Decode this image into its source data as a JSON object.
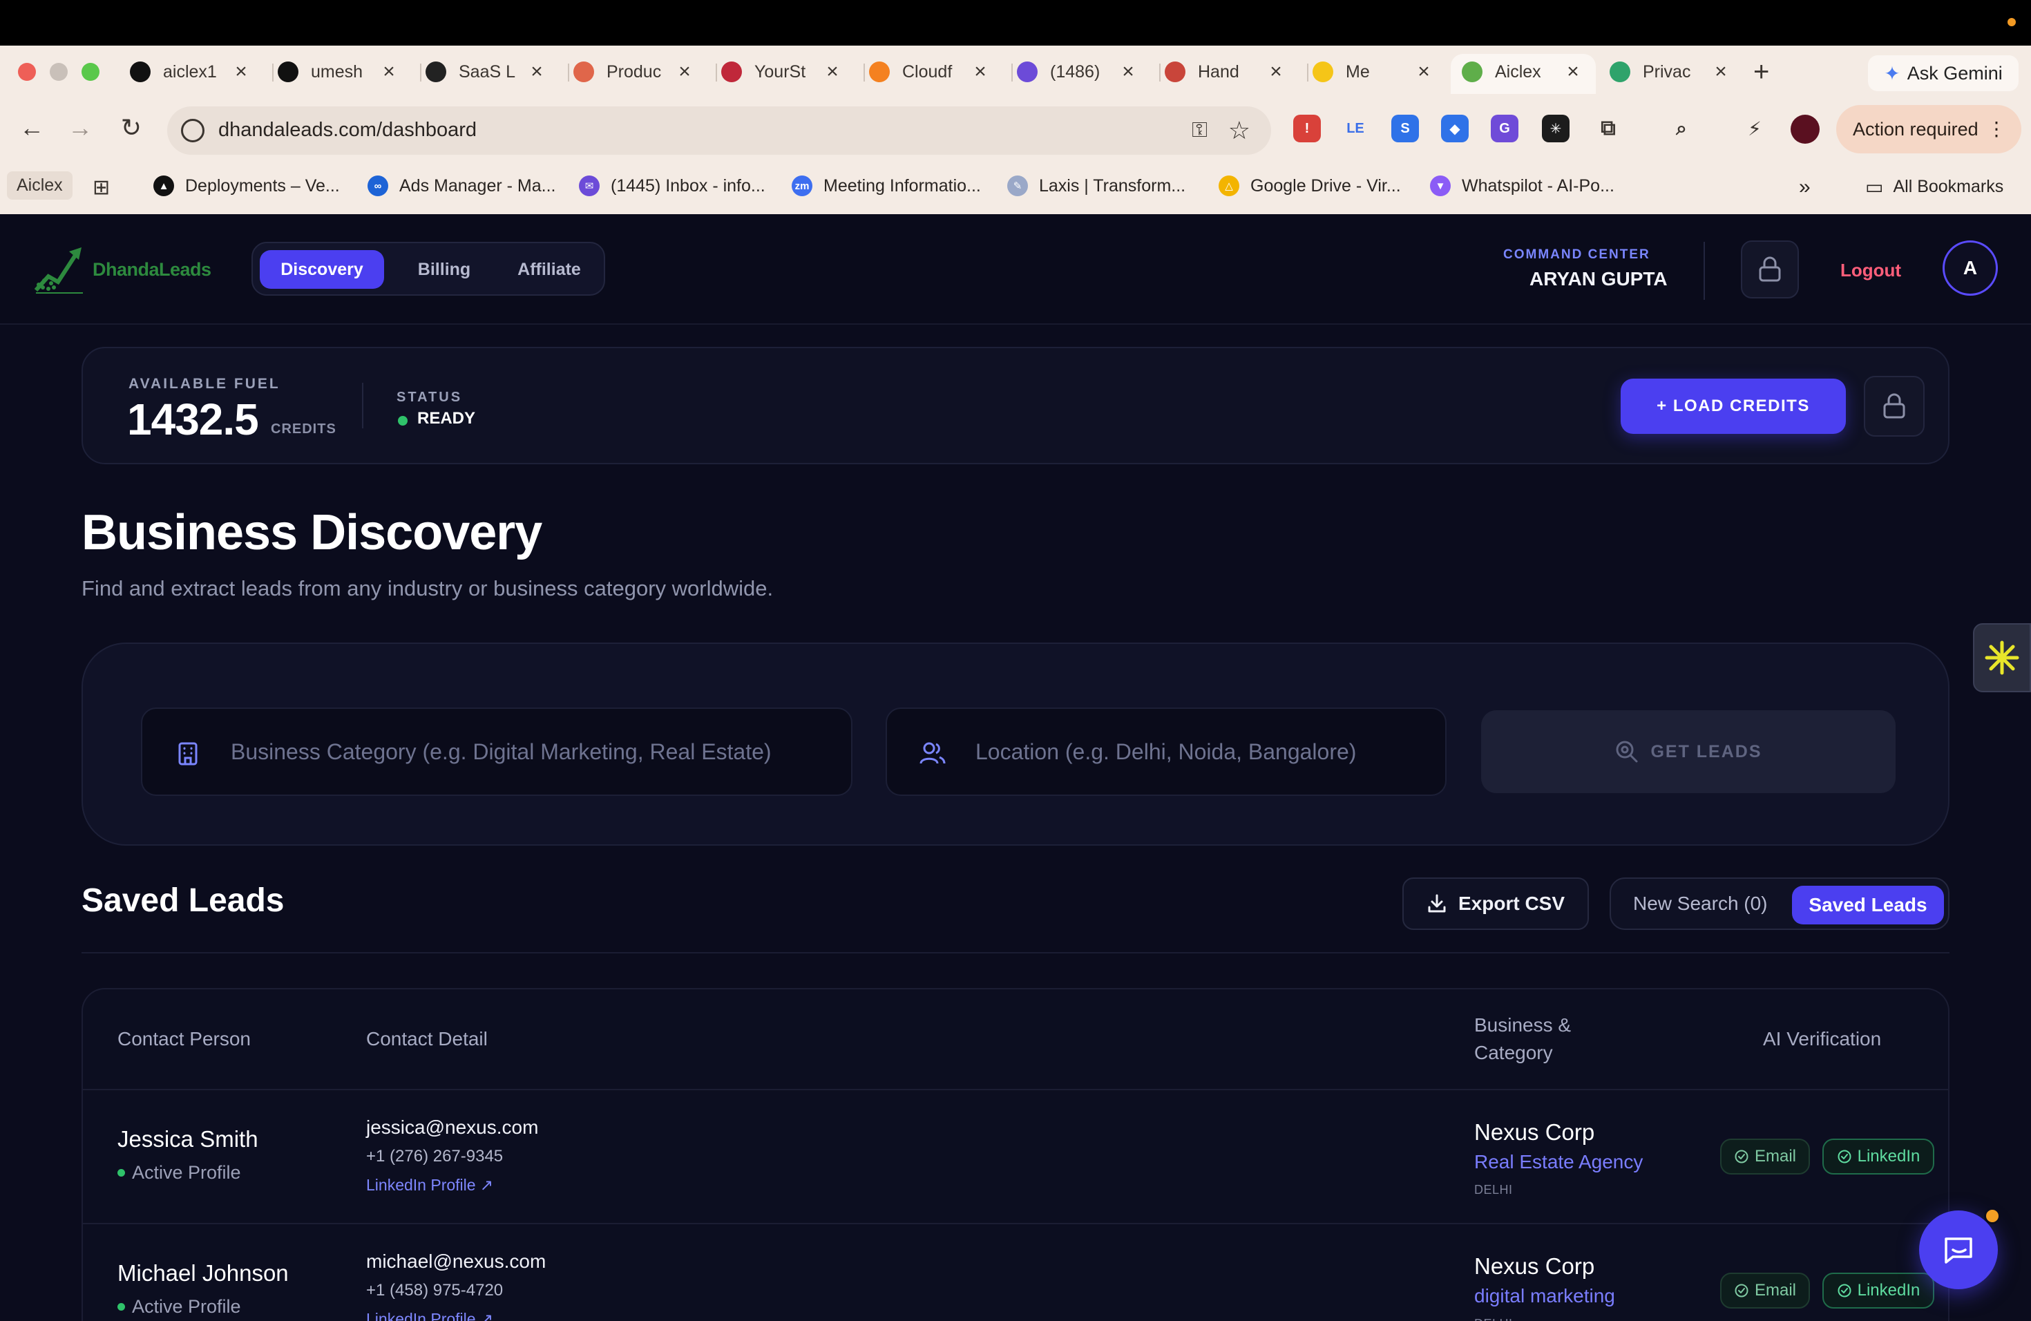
{
  "browser": {
    "tabs": [
      {
        "label": "aiclex1",
        "favicon": "triangle-icon",
        "color": "#111111"
      },
      {
        "label": "umesh",
        "favicon": "github-icon",
        "color": "#111111"
      },
      {
        "label": "SaaS L",
        "favicon": "openai-icon",
        "color": "#222222"
      },
      {
        "label": "Produc",
        "favicon": "producthunt-icon",
        "color": "#e0664a"
      },
      {
        "label": "YourSt",
        "favicon": "ys-icon",
        "color": "#c0283a"
      },
      {
        "label": "Cloudf",
        "favicon": "cloud-icon",
        "color": "#f48120"
      },
      {
        "label": "(1486)",
        "favicon": "inbox-icon",
        "color": "#6c4bd8"
      },
      {
        "label": "Hand",
        "favicon": "gmail-icon",
        "color": "#c9453a"
      },
      {
        "label": "Me",
        "favicon": "meet-icon",
        "color": "#f5c518"
      },
      {
        "label": "Aiclex",
        "favicon": "aiclex-icon",
        "color": "#5fae4a"
      },
      {
        "label": "Privac",
        "favicon": "send-icon",
        "color": "#2fa36b"
      }
    ],
    "gemini_label": "Ask Gemini",
    "url": "dhandaleads.com/dashboard",
    "action_required": "Action required",
    "extensions": [
      {
        "label": "!",
        "color": "#d9413a"
      },
      {
        "label": "LE",
        "color": "#f4ebe4"
      },
      {
        "label": "S",
        "color": "#2f72e8"
      },
      {
        "label": "◆",
        "color": "#2f72e8"
      },
      {
        "label": "G",
        "color": "#6f4bd8"
      },
      {
        "label": "✳",
        "color": "#1c1c1c"
      }
    ],
    "bookmarks": [
      {
        "label": "Deployments – Ve...",
        "icon": "vercel-icon",
        "color": "#111111",
        "glyph": "▲"
      },
      {
        "label": "Ads Manager - Ma...",
        "icon": "meta-icon",
        "color": "#1d63d6",
        "glyph": "∞"
      },
      {
        "label": "(1445) Inbox - info...",
        "icon": "inbox-icon",
        "color": "#6c4bd8",
        "glyph": "✉"
      },
      {
        "label": "Meeting Informatio...",
        "icon": "zoom-icon",
        "color": "#3d6ef0",
        "glyph": "zm"
      },
      {
        "label": "Laxis | Transform...",
        "icon": "laxis-icon",
        "color": "#9aa8c8",
        "glyph": "✎"
      },
      {
        "label": "Google Drive - Vir...",
        "icon": "drive-icon",
        "color": "#f3b400",
        "glyph": "△"
      },
      {
        "label": "Whatspilot - AI-Po...",
        "icon": "whatspilot-icon",
        "color": "#8b5cf6",
        "glyph": "▼"
      }
    ],
    "bookmark_aiclex": "Aiclex",
    "all_bookmarks": "All Bookmarks"
  },
  "header": {
    "logo_text": "DhandaLeads",
    "nav": [
      {
        "label": "Discovery",
        "active": true
      },
      {
        "label": "Billing",
        "active": false
      },
      {
        "label": "Affiliate",
        "active": false
      }
    ],
    "command_center_label": "COMMAND CENTER",
    "user_name": "ARYAN GUPTA",
    "logout_label": "Logout",
    "avatar_initial": "A"
  },
  "fuel": {
    "label": "AVAILABLE FUEL",
    "value": "1432.5",
    "unit": "CREDITS",
    "status_label": "STATUS",
    "status_value": "READY",
    "load_button": "+ LOAD CREDITS"
  },
  "discovery": {
    "title": "Business Discovery",
    "subtitle": "Find and extract leads from any industry or business category worldwide.",
    "category_placeholder": "Business Category (e.g. Digital Marketing, Real Estate)",
    "location_placeholder": "Location (e.g. Delhi, Noida, Bangalore)",
    "get_leads_button": "GET LEADS"
  },
  "saved": {
    "title": "Saved Leads",
    "export_button": "Export CSV",
    "toggle_new": "New Search (0)",
    "toggle_saved": "Saved Leads",
    "columns": {
      "contact_person": "Contact Person",
      "contact_detail": "Contact Detail",
      "business_category_1": "Business &",
      "business_category_2": "Category",
      "ai_verification": "AI Verification"
    },
    "rows": [
      {
        "name": "Jessica Smith",
        "status": "Active Profile",
        "email": "jessica@nexus.com",
        "phone": "+1 (276) 267-9345",
        "linkedin": "LinkedIn Profile ↗",
        "business": "Nexus Corp",
        "category": "Real Estate Agency",
        "city": "DELHI",
        "badge_email": "Email",
        "badge_linkedin": "LinkedIn"
      },
      {
        "name": "Michael Johnson",
        "status": "Active Profile",
        "email": "michael@nexus.com",
        "phone": "+1 (458) 975-4720",
        "linkedin": "LinkedIn Profile ↗",
        "business": "Nexus Corp",
        "category": "digital marketing",
        "city": "DELHI",
        "badge_email": "Email",
        "badge_linkedin": "LinkedIn"
      }
    ]
  },
  "colors": {
    "accent": "#4b3ff0",
    "status_green": "#2fc26a",
    "logout_red": "#ff5e7a"
  }
}
